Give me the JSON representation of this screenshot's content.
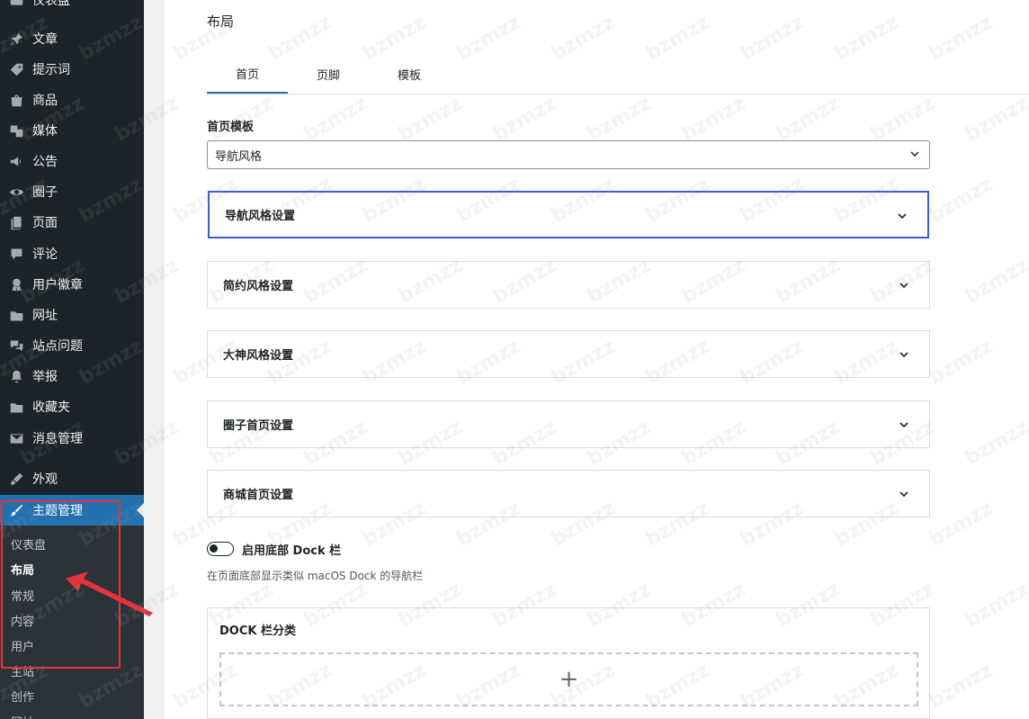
{
  "sidebar": {
    "top_cut_label": "仪表盘",
    "items": [
      {
        "label": "文章",
        "icon": "pushpin-icon"
      },
      {
        "label": "提示词",
        "icon": "tag-icon"
      },
      {
        "label": "商品",
        "icon": "shop-icon"
      },
      {
        "label": "媒体",
        "icon": "media-icon"
      },
      {
        "label": "公告",
        "icon": "megaphone-icon"
      },
      {
        "label": "圈子",
        "icon": "visibility-icon"
      },
      {
        "label": "页面",
        "icon": "page-icon"
      },
      {
        "label": "评论",
        "icon": "comment-icon"
      },
      {
        "label": "用户徽章",
        "icon": "award-icon"
      },
      {
        "label": "网址",
        "icon": "folder-icon"
      },
      {
        "label": "站点问题",
        "icon": "forum-icon"
      },
      {
        "label": "举报",
        "icon": "bell-icon"
      },
      {
        "label": "收藏夹",
        "icon": "folder-icon"
      },
      {
        "label": "消息管理",
        "icon": "email-icon"
      },
      {
        "label": "外观",
        "icon": "appearance-icon"
      },
      {
        "label": "主题管理",
        "icon": "brush-icon"
      }
    ],
    "submenu": [
      "仪表盘",
      "布局",
      "常规",
      "内容",
      "用户",
      "主站",
      "创作",
      "网址"
    ]
  },
  "main": {
    "title": "布局",
    "tabs": [
      "首页",
      "页脚",
      "模板"
    ],
    "active_tab": "首页",
    "home_template_label": "首页模板",
    "home_template_value": "导航风格",
    "panels": [
      "导航风格设置",
      "简约风格设置",
      "大神风格设置",
      "圈子首页设置",
      "商城首页设置"
    ],
    "dock_toggle_label": "启用底部 Dock 栏",
    "dock_toggle_on": false,
    "dock_help": "在页面底部显示类似 macOS Dock 的导航栏",
    "dock_category_title": "DOCK 栏分类",
    "dock_add_symbol": "+"
  },
  "watermark": "bzmzz",
  "colors": {
    "sidebar_bg": "#1d2327",
    "submenu_bg": "#2c3338",
    "accent": "#2271b1",
    "focus_border": "#3858e9",
    "annotation_red": "#e6323c"
  }
}
